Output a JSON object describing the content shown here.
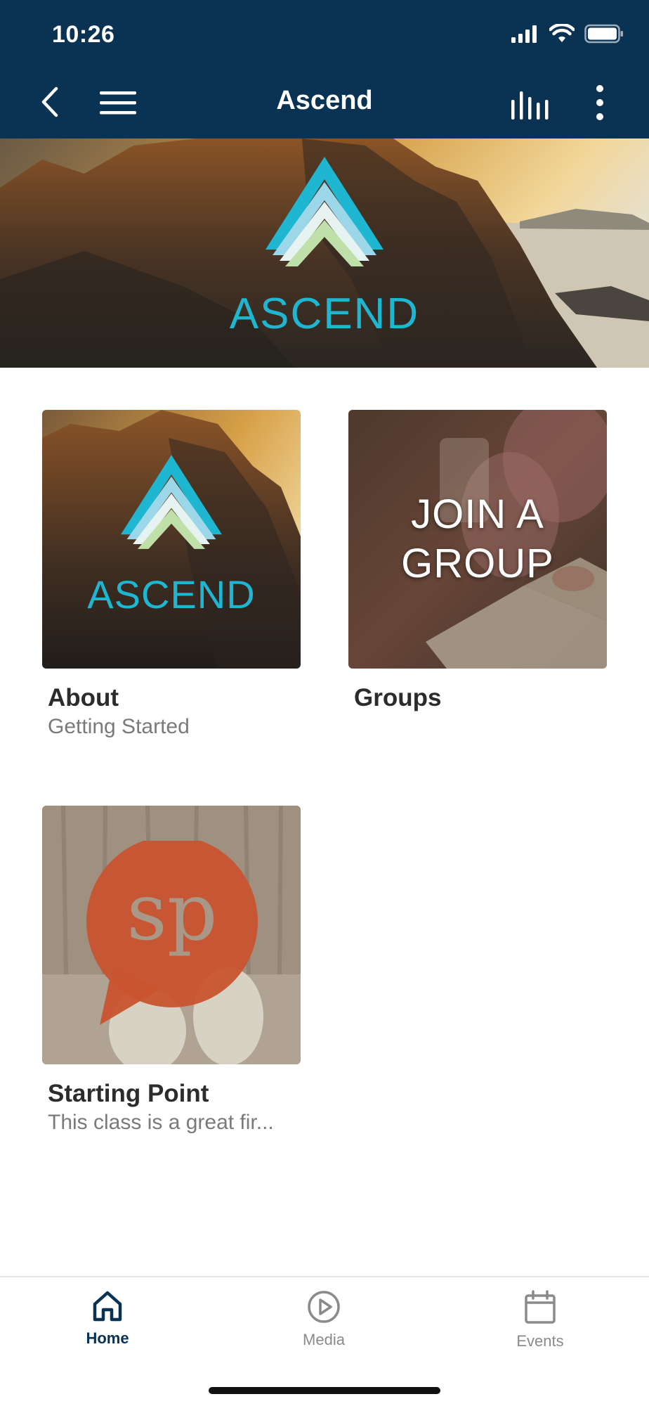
{
  "status": {
    "time": "10:26"
  },
  "nav": {
    "title": "Ascend"
  },
  "hero": {
    "logo_text": "ASCEND"
  },
  "tiles": [
    {
      "image_text": "ASCEND",
      "title": "About",
      "subtitle": "Getting Started"
    },
    {
      "image_text_line1": "JOIN A",
      "image_text_line2": "GROUP",
      "title": "Groups",
      "subtitle": ""
    },
    {
      "image_text": "sp",
      "title": "Starting Point",
      "subtitle": "This class is a great fir..."
    }
  ],
  "tabs": [
    {
      "label": "Home",
      "icon": "home-icon",
      "active": true
    },
    {
      "label": "Media",
      "icon": "play-circle-icon",
      "active": false
    },
    {
      "label": "Events",
      "icon": "calendar-icon",
      "active": false
    }
  ],
  "colors": {
    "navbar": "#0a3253",
    "brand_teal": "#1eb6d0",
    "tab_active": "#0a3253",
    "tab_inactive": "#8a8a8a",
    "sp_orange": "#c9542f"
  }
}
